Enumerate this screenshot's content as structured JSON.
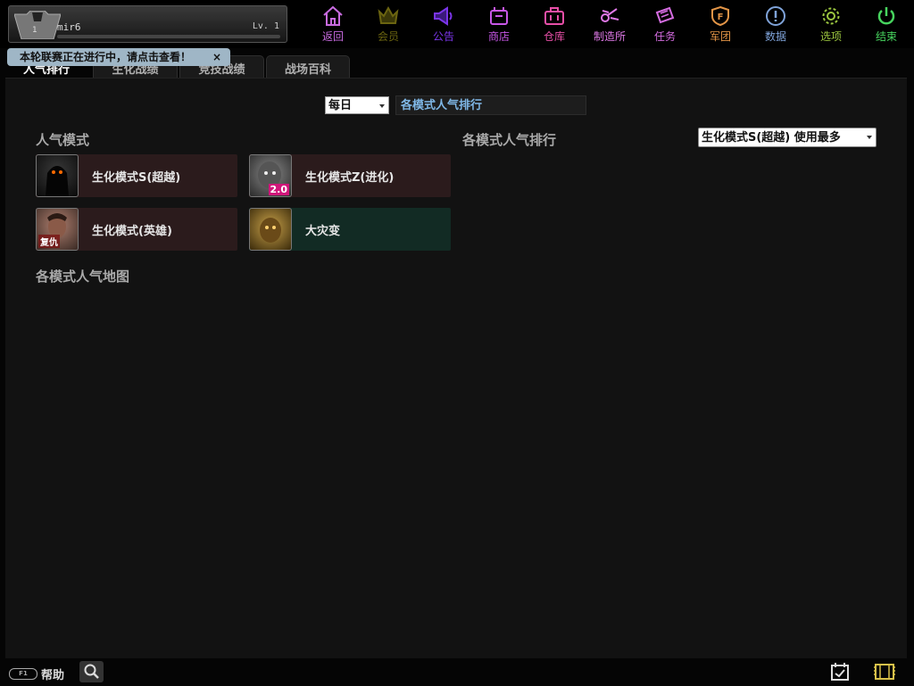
{
  "player": {
    "level_num": "1",
    "name": "mir6",
    "level_text": "Lv. 1"
  },
  "nav": [
    {
      "label": "返回",
      "icon": "home-icon",
      "color": "#c86be0"
    },
    {
      "label": "会员",
      "icon": "crown-icon",
      "color": "#6b6410"
    },
    {
      "label": "公告",
      "icon": "megaphone-icon",
      "color": "#7a35e8"
    },
    {
      "label": "商店",
      "icon": "shop-icon",
      "color": "#c857e8"
    },
    {
      "label": "仓库",
      "icon": "bag-icon",
      "color": "#e84fa8"
    },
    {
      "label": "制造所",
      "icon": "workshop-icon",
      "color": "#e079e8"
    },
    {
      "label": "任务",
      "icon": "scroll-icon",
      "color": "#d46ce0"
    },
    {
      "label": "军团",
      "icon": "shield-icon",
      "color": "#e39547"
    },
    {
      "label": "数据",
      "icon": "info-icon",
      "color": "#7fa3d9"
    },
    {
      "label": "选项",
      "icon": "gear-icon",
      "color": "#9bc63f"
    },
    {
      "label": "结束",
      "icon": "power-icon",
      "color": "#47d45e"
    }
  ],
  "notice": {
    "text": "本轮联赛正在进行中，请点击查看！",
    "close": "×"
  },
  "tabs": [
    "人气排行",
    "生化战绩",
    "竞技战绩",
    "战场百科"
  ],
  "filter": {
    "period": "每日",
    "ranking_title": "各模式人气排行"
  },
  "sections": {
    "popular_modes": "人气模式",
    "mode_ranking": "各模式人气排行",
    "popular_maps": "各模式人气地图"
  },
  "mode_dropdown": "生化模式S(超越) 使用最多",
  "modes": [
    {
      "label": "生化模式S(超越)",
      "bg": "#2b1b1c"
    },
    {
      "label": "生化模式Z(进化)",
      "bg": "#2b1b1c",
      "badge": "2.0"
    },
    {
      "label": "生化模式(英雄)",
      "bg": "#2b1b1c",
      "badge": "复仇"
    },
    {
      "label": "大灾变",
      "bg": "#122b24"
    }
  ],
  "bottom": {
    "help": "帮助",
    "kbd": "F1"
  }
}
